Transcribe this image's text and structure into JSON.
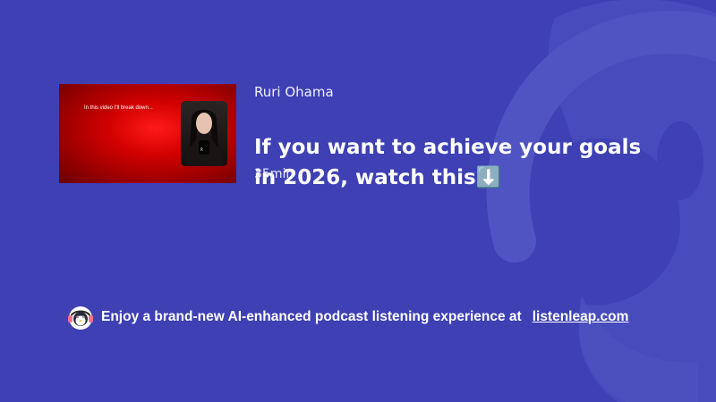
{
  "colors": {
    "background": "#3e40b4",
    "accent_red": "#d20000",
    "text": "#ffffff"
  },
  "episode": {
    "thumbnail_caption": "In this video I'll break down...",
    "author": "Ruri Ohama",
    "title": "If you want to achieve your goals in 2026, watch this⬇️",
    "duration": "35min"
  },
  "promo": {
    "icon": "penguin-headphones-icon",
    "text": "Enjoy a brand-new AI-enhanced podcast listening experience at",
    "link_text": "listenleap.com"
  },
  "background_icon": "penguin-watermark-icon"
}
